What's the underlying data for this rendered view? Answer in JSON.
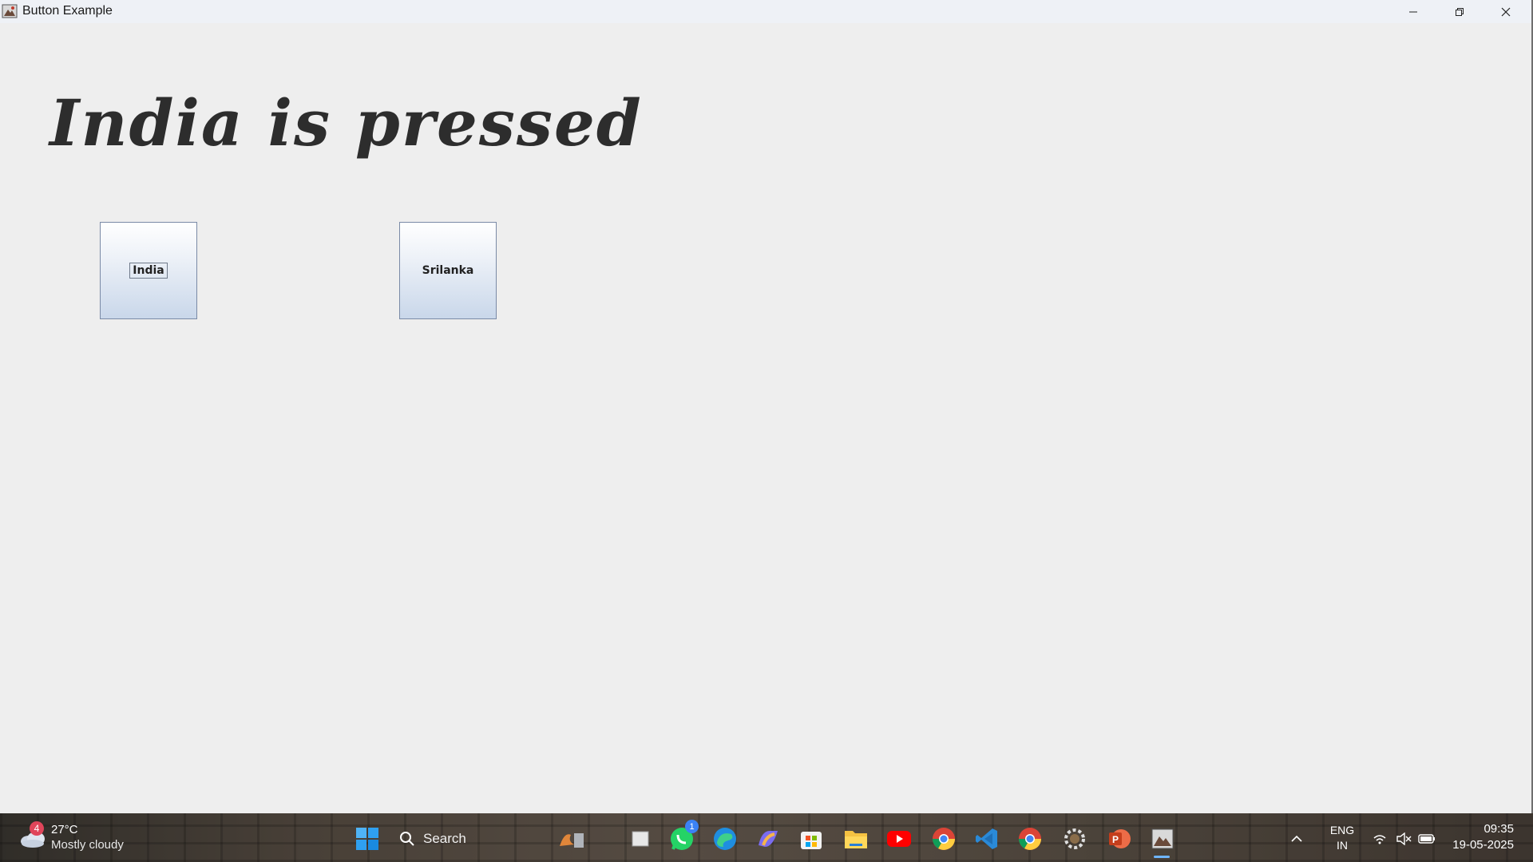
{
  "window": {
    "title": "Button Example",
    "controls": {
      "minimize": "minimize-icon",
      "maximize": "restore-icon",
      "close": "close-icon"
    }
  },
  "main": {
    "status_label": "India is pressed",
    "buttons": [
      {
        "label": "India",
        "focused": true
      },
      {
        "label": "Srilanka",
        "focused": false
      }
    ]
  },
  "taskbar": {
    "weather": {
      "badge": "4",
      "temperature": "27°C",
      "description": "Mostly cloudy"
    },
    "search_placeholder": "Search",
    "whatsapp_badge": "1",
    "language": {
      "line1": "ENG",
      "line2": "IN"
    },
    "clock": {
      "time": "09:35",
      "date": "19-05-2025"
    },
    "pinned_apps": [
      "windows-start-icon",
      "search-icon",
      "files-app-icon",
      "task-view-icon",
      "whatsapp-icon",
      "edge-icon",
      "copilot-icon",
      "microsoft-store-icon",
      "file-explorer-icon",
      "youtube-icon",
      "chrome-icon",
      "vscode-icon",
      "chrome-profile-icon",
      "settings-icon",
      "powerpoint-icon",
      "java-app-icon"
    ],
    "tray": [
      "chevron-up-icon",
      "wifi-icon",
      "volume-muted-icon",
      "battery-icon"
    ]
  }
}
